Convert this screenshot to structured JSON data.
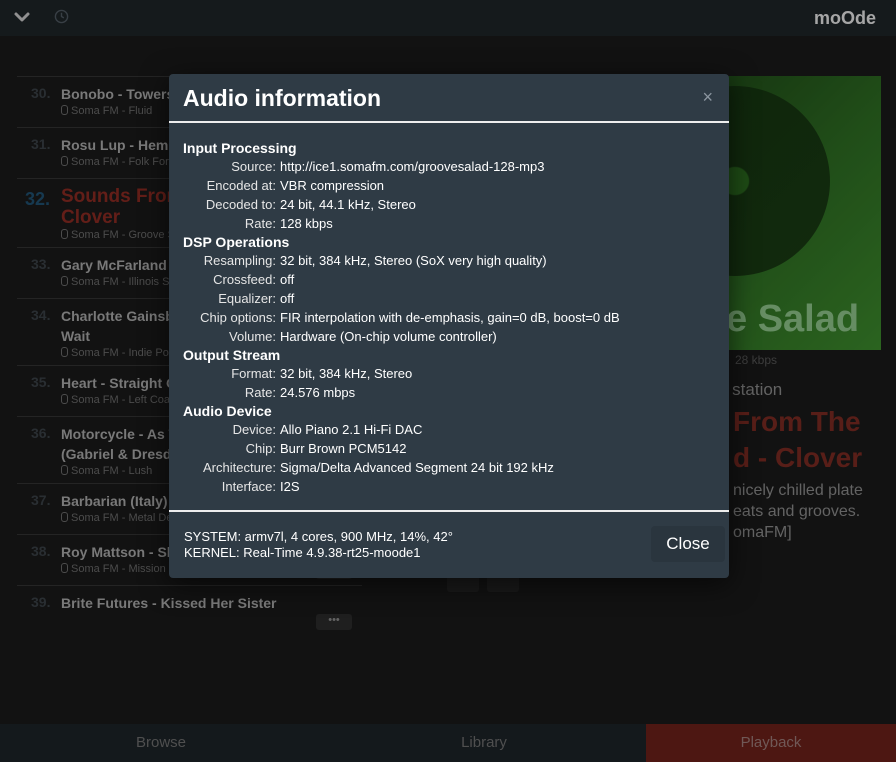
{
  "topbar": {
    "brand": "moOde",
    "menu_icon": "chevron-down-icon",
    "clock_icon": "clock-icon"
  },
  "playlist": [
    {
      "num": "30.",
      "title": "Bonobo - Towers",
      "sub": "Soma FM - Fluid"
    },
    {
      "num": "31.",
      "title": "Rosu Lup - Hem",
      "sub": "Soma FM - Folk Forw"
    },
    {
      "num": "32.",
      "title": "Sounds From\nClover",
      "sub": "Soma FM - Groove S",
      "active": true
    },
    {
      "num": "33.",
      "title": "Gary McFarland",
      "sub": "Soma FM - Illinois St"
    },
    {
      "num": "34.",
      "title": "Charlotte Gainsb\nWait",
      "sub": "Soma FM - Indie Pop"
    },
    {
      "num": "35.",
      "title": "Heart - Straight O",
      "sub": "Soma FM - Left Coas"
    },
    {
      "num": "36.",
      "title": "Motorcycle - As T\n(Gabriel & Dresde",
      "sub": "Soma FM - Lush"
    },
    {
      "num": "37.",
      "title": "Barbarian (Italy)",
      "sub": "Soma FM - Metal De"
    },
    {
      "num": "38.",
      "title": "Roy Mattson - Sh",
      "sub": "Soma FM - Mission Control"
    },
    {
      "num": "39.",
      "title": "Brite Futures - Kissed Her Sister",
      "sub": ""
    }
  ],
  "playlist_more_label": "•••",
  "nowplaying": {
    "cover_text": "e Salad",
    "bitrate": "28 kbps",
    "station": "o station",
    "title": "From The\nd - Clover",
    "description": "nicely chilled plate\neats and grooves.\nomaFM]"
  },
  "bottomnav": {
    "browse": "Browse",
    "library": "Library",
    "playback": "Playback"
  },
  "modal": {
    "title": "Audio information",
    "close_x": "×",
    "sections": [
      {
        "title": "Input Processing",
        "rows": [
          {
            "k": "Source:",
            "v": "http://ice1.somafm.com/groovesalad-128-mp3"
          },
          {
            "k": "Encoded at:",
            "v": "VBR compression"
          },
          {
            "k": "Decoded to:",
            "v": "24 bit, 44.1 kHz, Stereo"
          },
          {
            "k": "Rate:",
            "v": "128 kbps"
          }
        ]
      },
      {
        "title": "DSP Operations",
        "rows": [
          {
            "k": "Resampling:",
            "v": "32 bit, 384 kHz, Stereo (SoX very high quality)"
          },
          {
            "k": "Crossfeed:",
            "v": "off"
          },
          {
            "k": "Equalizer:",
            "v": "off"
          },
          {
            "k": "Chip options:",
            "v": "FIR interpolation with de-emphasis, gain=0 dB, boost=0 dB"
          },
          {
            "k": "Volume:",
            "v": "Hardware (On-chip volume controller)"
          }
        ]
      },
      {
        "title": "Output Stream",
        "rows": [
          {
            "k": "Format:",
            "v": "32 bit, 384 kHz, Stereo"
          },
          {
            "k": "Rate:",
            "v": "24.576 mbps"
          }
        ]
      },
      {
        "title": "Audio Device",
        "rows": [
          {
            "k": "Device:",
            "v": "Allo Piano 2.1 Hi-Fi DAC"
          },
          {
            "k": "Chip:",
            "v": "Burr Brown PCM5142"
          },
          {
            "k": "Architecture:",
            "v": "Sigma/Delta Advanced Segment 24 bit 192 kHz"
          },
          {
            "k": "Interface:",
            "v": "I2S"
          }
        ]
      }
    ],
    "system_line": "SYSTEM: armv7l, 4 cores, 900 MHz, 14%, 42°",
    "kernel_line": "KERNEL: Real-Time 4.9.38-rt25-moode1",
    "close_button": "Close"
  }
}
